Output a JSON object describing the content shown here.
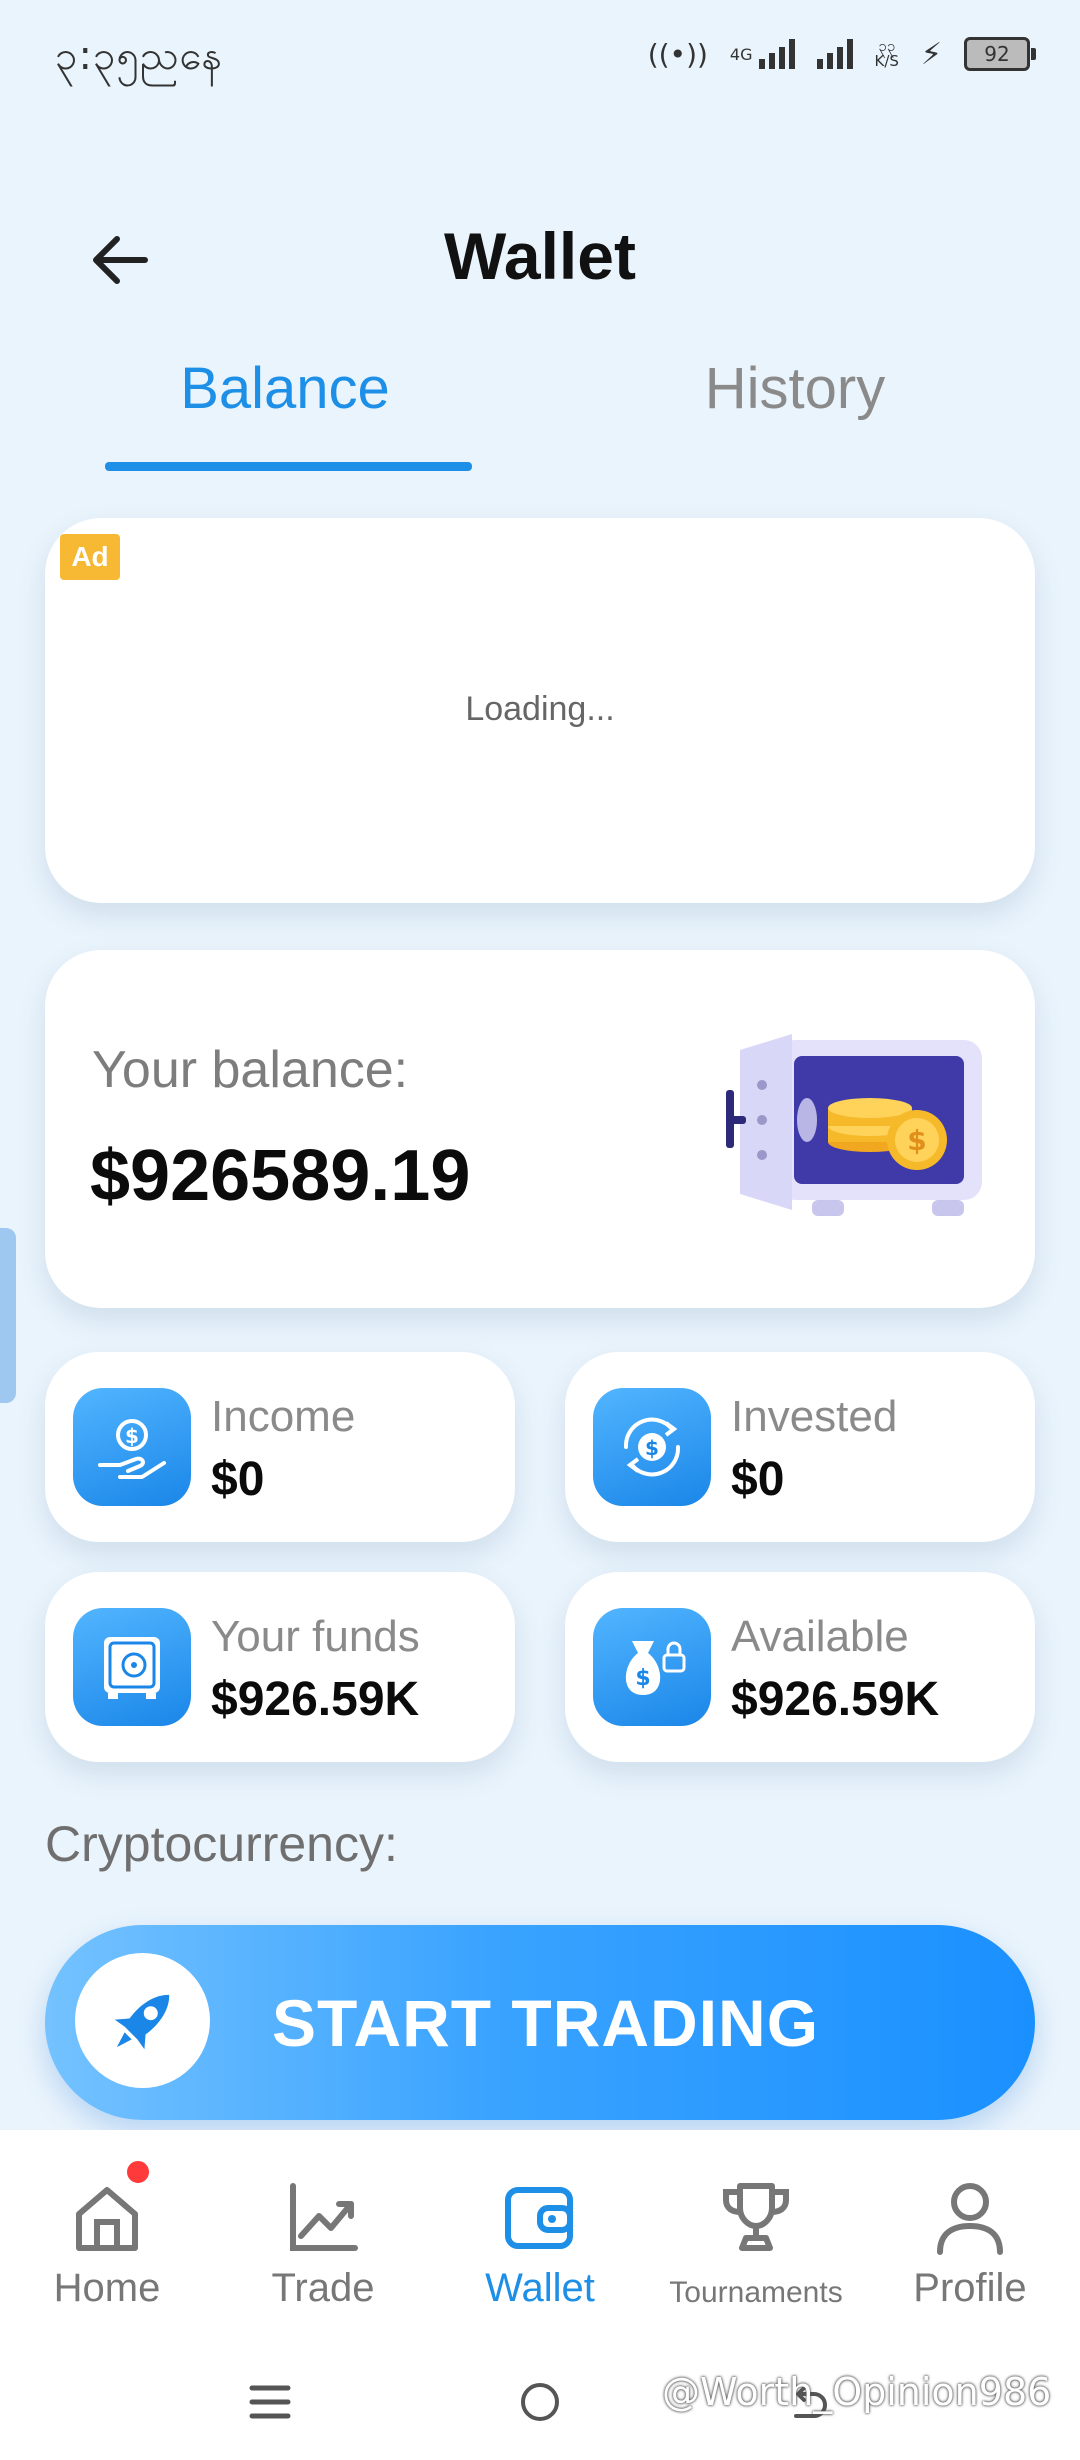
{
  "status_bar": {
    "time": "၃:၃၅ညနေ",
    "network_type": "4G",
    "net_speed_value": "၃၃",
    "net_speed_unit": "K/S",
    "battery": "92"
  },
  "header": {
    "title": "Wallet",
    "back_icon": "arrow-left-icon"
  },
  "tabs": [
    {
      "label": "Balance",
      "active": true
    },
    {
      "label": "History",
      "active": false
    }
  ],
  "ad": {
    "badge": "Ad",
    "loading_text": "Loading..."
  },
  "balance": {
    "label": "Your balance:",
    "value": "$926589.19"
  },
  "stats": [
    {
      "label": "Income",
      "value": "$0",
      "icon": "hand-coin-icon"
    },
    {
      "label": "Invested",
      "value": "$0",
      "icon": "coin-cycle-icon"
    },
    {
      "label": "Your funds",
      "value": "$926.59K",
      "icon": "safe-icon"
    },
    {
      "label": "Available",
      "value": "$926.59K",
      "icon": "money-bag-lock-icon"
    }
  ],
  "section": {
    "crypto_title": "Cryptocurrency:"
  },
  "cta": {
    "label": "START TRADING",
    "icon": "rocket-icon"
  },
  "bottom_nav": [
    {
      "label": "Home",
      "icon": "home-icon",
      "active": false,
      "badge": true
    },
    {
      "label": "Trade",
      "icon": "chart-line-icon",
      "active": false
    },
    {
      "label": "Wallet",
      "icon": "wallet-icon",
      "active": true
    },
    {
      "label": "Tournaments",
      "icon": "trophy-icon",
      "active": false
    },
    {
      "label": "Profile",
      "icon": "user-icon",
      "active": false
    }
  ],
  "watermark": "@Worth_Opinion986",
  "colors": {
    "accent": "#1e8fe6",
    "background": "#eaf4fc",
    "ad_badge": "#f7b833",
    "notification": "#ff3a3a"
  }
}
